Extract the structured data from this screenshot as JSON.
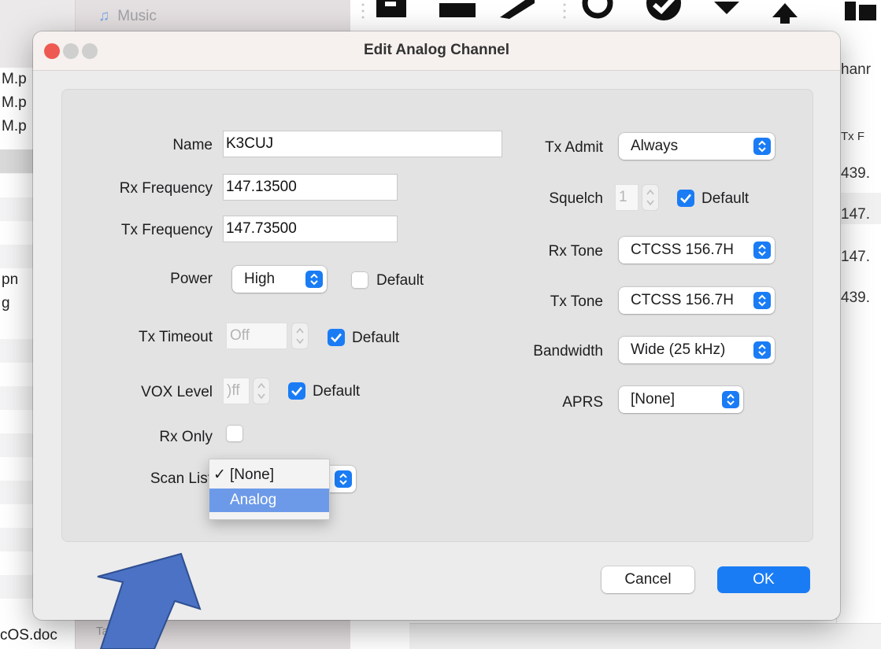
{
  "background": {
    "sidebar_item": "Music",
    "left_list": [
      "M.p",
      "M.p",
      "M.p",
      "",
      "",
      "",
      "",
      "",
      "pn",
      "g"
    ],
    "bottom_left_text": "cOS.doc",
    "bottom_tag_text": "Tag",
    "right_column": {
      "header_partial": "hanr",
      "col_header": "Tx F",
      "values": [
        "439.",
        "147.",
        "147.",
        "439."
      ]
    }
  },
  "dialog": {
    "title": "Edit Analog Channel",
    "left": {
      "name_label": "Name",
      "name_value": "K3CUJ",
      "rx_freq_label": "Rx Frequency",
      "rx_freq_value": "147.13500",
      "tx_freq_label": "Tx Frequency",
      "tx_freq_value": "147.73500",
      "power_label": "Power",
      "power_value": "High",
      "power_default_label": "Default",
      "tx_timeout_label": "Tx Timeout",
      "tx_timeout_value": "Off",
      "tx_timeout_default_label": "Default",
      "vox_label": "VOX Level",
      "vox_value": ")ff",
      "vox_default_label": "Default",
      "rx_only_label": "Rx Only",
      "scan_list_label": "Scan List"
    },
    "right": {
      "tx_admit_label": "Tx Admit",
      "tx_admit_value": "Always",
      "squelch_label": "Squelch",
      "squelch_value": "1",
      "squelch_default_label": "Default",
      "rx_tone_label": "Rx Tone",
      "rx_tone_value": "CTCSS 156.7H",
      "tx_tone_label": "Tx Tone",
      "tx_tone_value": "CTCSS 156.7H",
      "bandwidth_label": "Bandwidth",
      "bandwidth_value": "Wide (25 kHz)",
      "aprs_label": "APRS",
      "aprs_value": "[None]"
    },
    "scan_menu": {
      "items": [
        {
          "label": "[None]",
          "checkmark": "✓"
        },
        {
          "label": "Analog"
        }
      ],
      "highlighted": "Analog"
    },
    "buttons": {
      "cancel": "Cancel",
      "ok": "OK"
    }
  },
  "colors": {
    "accent": "#1a7cf5",
    "menu_highlight": "#6d9ae8",
    "overlay_arrow": "#4b72c4",
    "traffic_close": "#ee5a52",
    "traffic_inactive": "#cfcfcf"
  }
}
